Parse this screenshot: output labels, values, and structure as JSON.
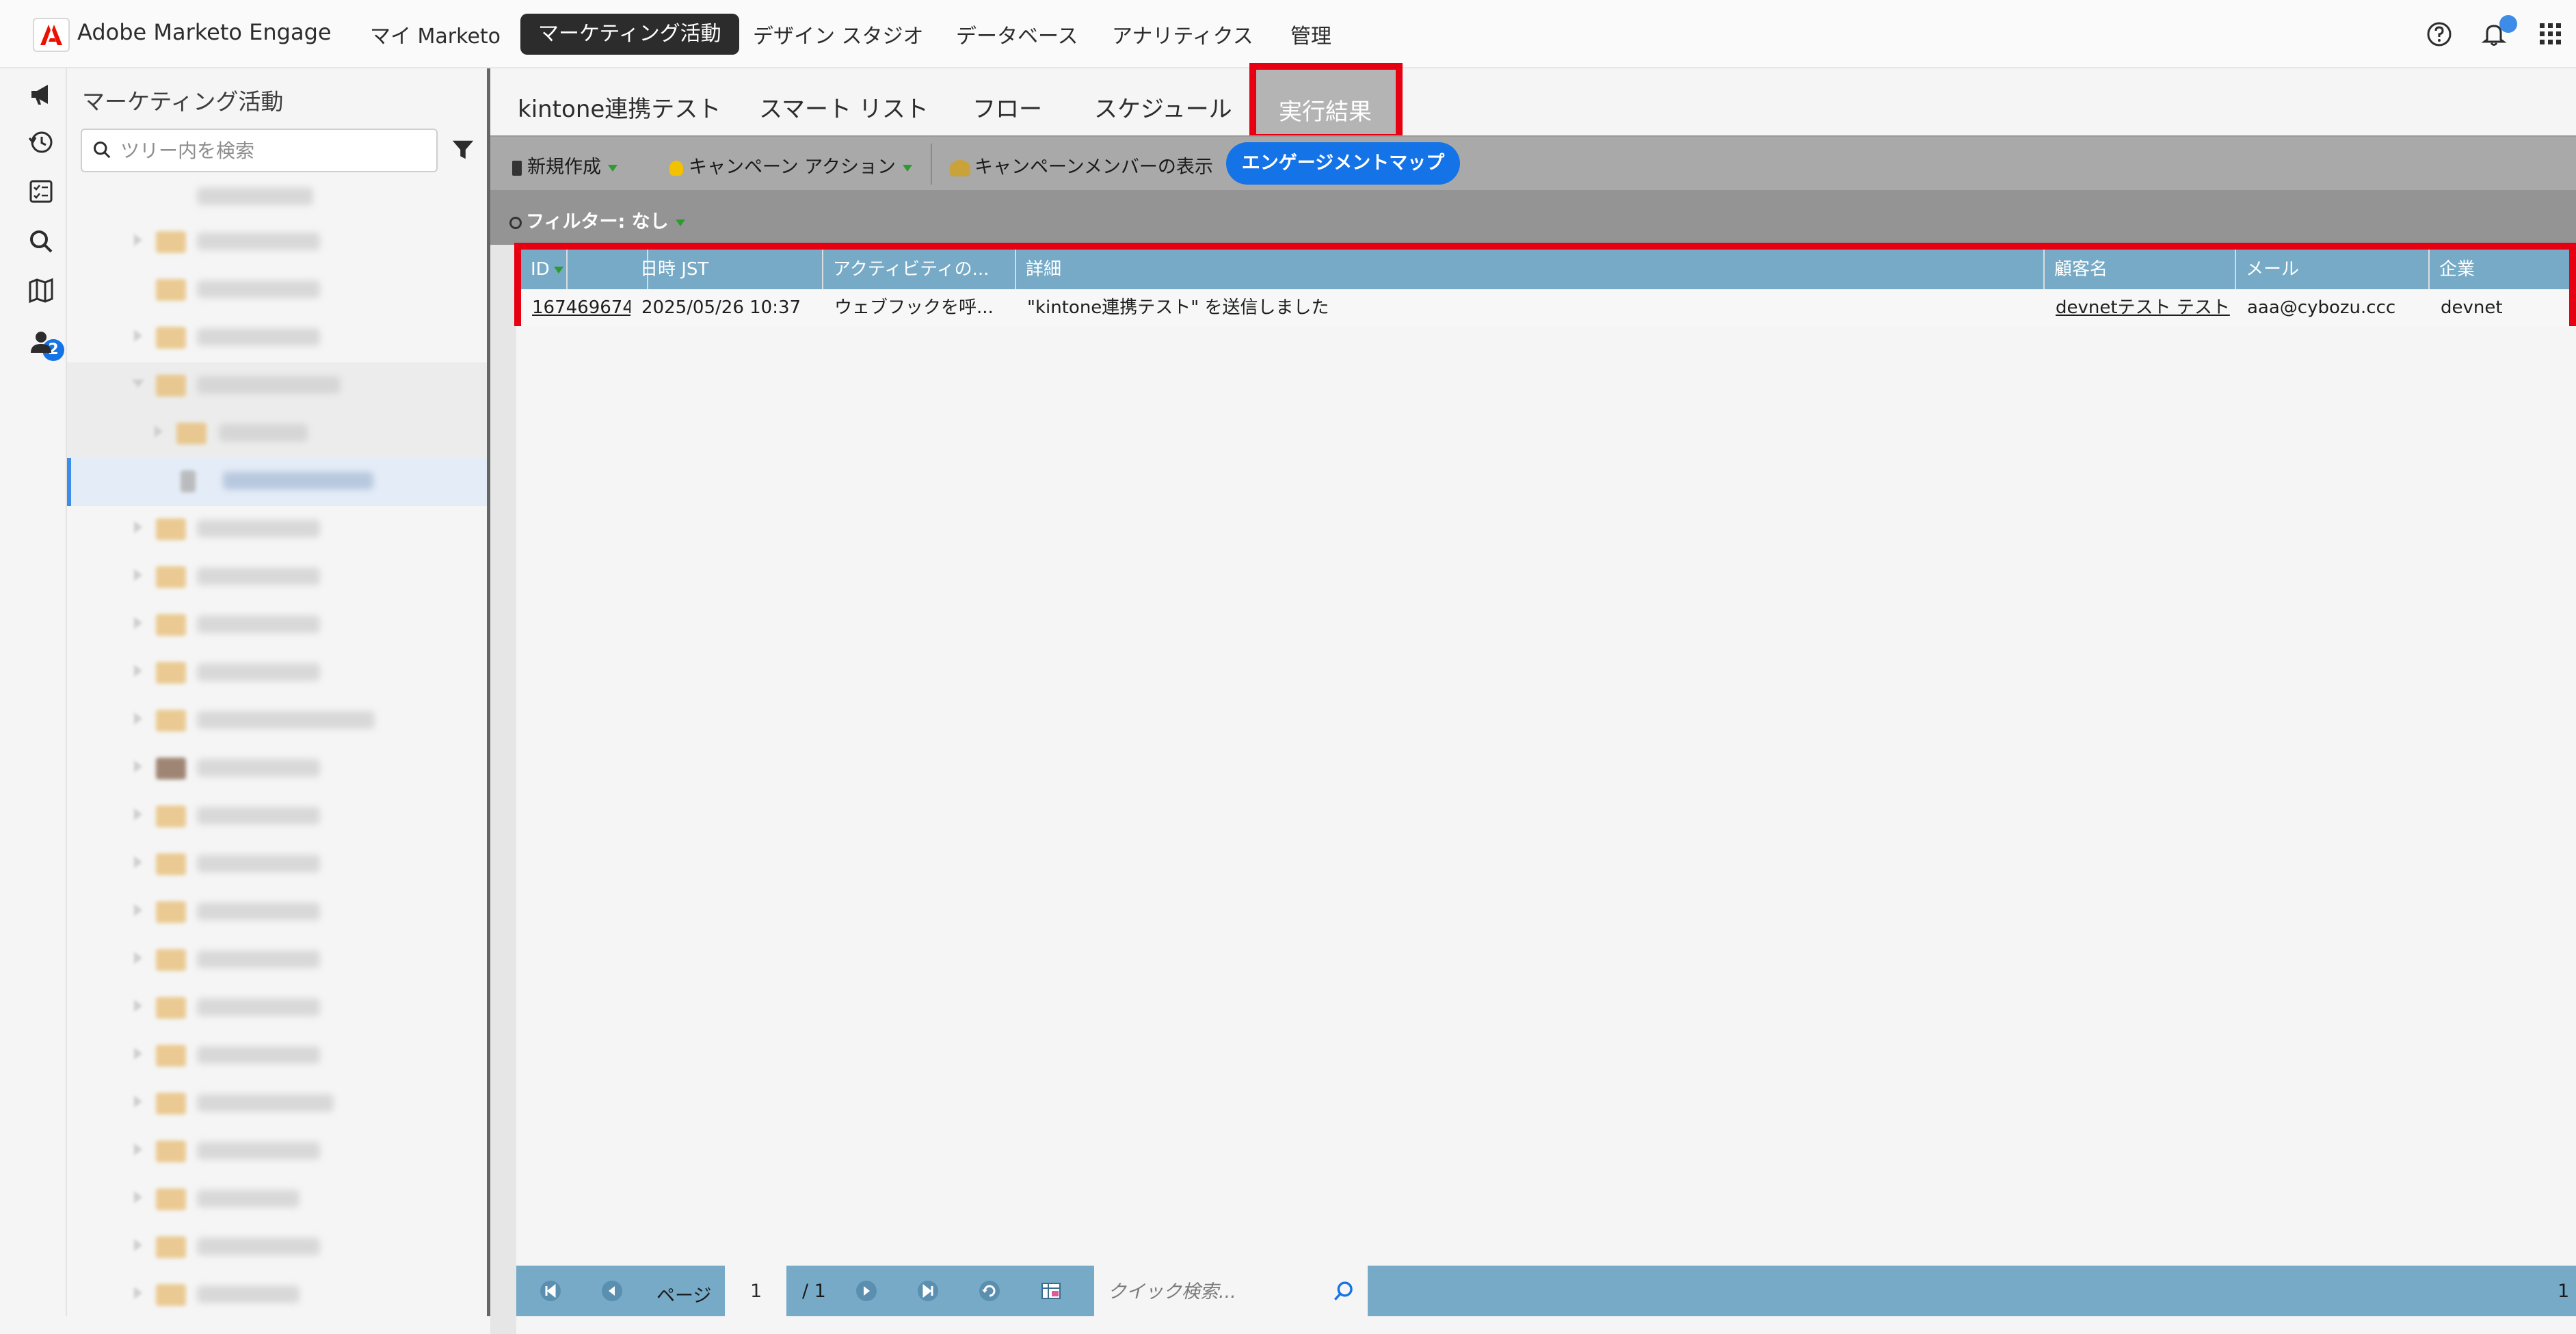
{
  "brand": "Adobe Marketo Engage",
  "topnav": {
    "items": [
      "マイ Marketo",
      "マーケティング活動",
      "デザイン スタジオ",
      "データベース",
      "アナリティクス",
      "管理"
    ],
    "active": "マーケティング活動"
  },
  "rail": {
    "badge_count": "2"
  },
  "tree": {
    "title": "マーケティング活動",
    "search_placeholder": "ツリー内を検索"
  },
  "tabs": {
    "items": [
      "kintone連携テスト",
      "スマート リスト",
      "フロー",
      "スケジュール"
    ],
    "active": "実行結果"
  },
  "toolbar": {
    "new_label": "新規作成",
    "campaign_action_label": "キャンペーン アクション",
    "show_members_label": "キャンペーンメンバーの表示",
    "engagement_map_label": "エンゲージメントマップ"
  },
  "filterbar": {
    "label": "フィルター: なし"
  },
  "table": {
    "headers": [
      "ID",
      "日時 JST",
      "アクティビティの...",
      "詳細",
      "顧客名",
      "メール",
      "企業"
    ],
    "rows": [
      {
        "id": "167469674",
        "datetime": "2025/05/26 10:37",
        "activity": "ウェブフックを呼...",
        "detail": "\"kintone連携テスト\" を送信しました",
        "customer": "devnetテスト テスト",
        "email": "aaa@cybozu.ccc",
        "company": "devnet"
      }
    ]
  },
  "pager": {
    "page_label": "ページ",
    "current_page": "1",
    "total_pages": "/ 1",
    "quick_search_placeholder": "クイック検索...",
    "right_text": "1"
  },
  "colors": {
    "accent_red": "#e60012",
    "header_blue": "#76aac6",
    "primary_blue": "#1473e6"
  }
}
